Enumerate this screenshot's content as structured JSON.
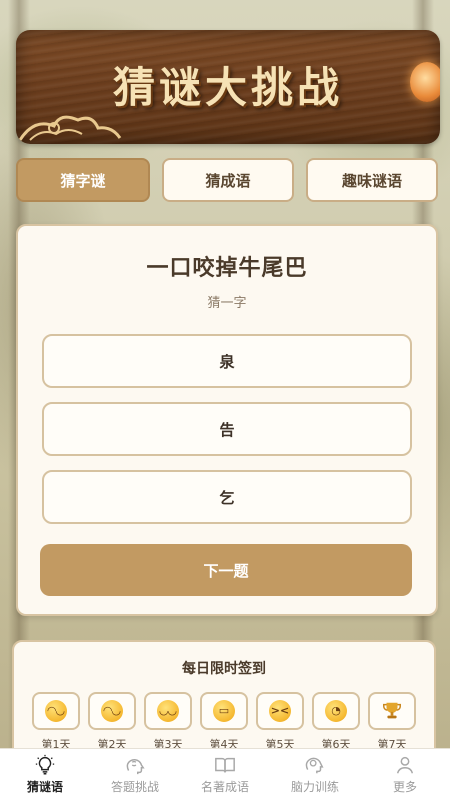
{
  "banner": {
    "title": "猜谜大挑战"
  },
  "tabs": [
    {
      "label": "猜字谜",
      "active": true
    },
    {
      "label": "猜成语",
      "active": false
    },
    {
      "label": "趣味谜语",
      "active": false
    }
  ],
  "quiz": {
    "riddle": "一口咬掉牛尾巴",
    "hint": "猜一字",
    "options": [
      "泉",
      "告",
      "乞"
    ],
    "next_label": "下一题"
  },
  "checkin": {
    "title": "每日限时签到",
    "days": [
      {
        "label": "第1天",
        "icon": "smile-emoji-icon",
        "glyph": "◠◡"
      },
      {
        "label": "第2天",
        "icon": "smile-emoji-icon",
        "glyph": "◠◡"
      },
      {
        "label": "第3天",
        "icon": "happy-emoji-icon",
        "glyph": "◡◡"
      },
      {
        "label": "第4天",
        "icon": "grin-emoji-icon",
        "glyph": "▭"
      },
      {
        "label": "第5天",
        "icon": "laugh-emoji-icon",
        "glyph": "><"
      },
      {
        "label": "第6天",
        "icon": "kiss-emoji-icon",
        "glyph": "◔"
      },
      {
        "label": "第7天",
        "icon": "trophy-icon",
        "glyph": "🏆"
      }
    ]
  },
  "bottom_nav": [
    {
      "label": "猜谜语",
      "icon": "lightbulb-icon",
      "active": true
    },
    {
      "label": "答题挑战",
      "icon": "brain-head-icon",
      "active": false
    },
    {
      "label": "名著成语",
      "icon": "open-book-icon",
      "active": false
    },
    {
      "label": "脑力训练",
      "icon": "brain-icon",
      "active": false
    },
    {
      "label": "更多",
      "icon": "user-icon",
      "active": false
    }
  ],
  "colors": {
    "accent": "#c29a62",
    "wood": "#6b3d1d",
    "card_bg": "#fdf9f1",
    "border": "#d6c2a0"
  }
}
